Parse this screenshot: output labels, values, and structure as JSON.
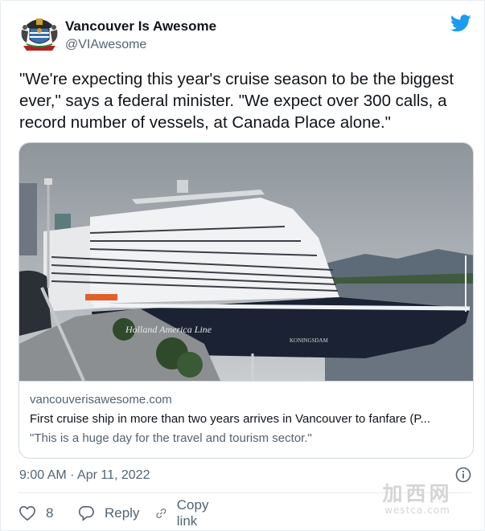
{
  "account": {
    "display_name": "Vancouver Is Awesome",
    "handle": "@VIAwesome",
    "avatar_icon": "vancouver-coat-of-arms-icon",
    "platform_icon": "twitter-bird-icon",
    "platform_color": "#1d9bf0"
  },
  "tweet": {
    "text": "\"We're expecting this year's cruise season to be the biggest ever,\" says a federal minister. \"We expect over 300 calls, a record number of vessels, at Canada Place alone.\"",
    "timestamp": "9:00 AM · Apr 11, 2022"
  },
  "link_card": {
    "photo_caption_hull": "Holland America Line",
    "photo_caption_bow": "KONINGSDAM",
    "domain": "vancouverisawesome.com",
    "title": "First cruise ship in more than two years arrives in Vancouver to fanfare (P...",
    "description": "\"This is a huge day for the travel and tourism sector.\""
  },
  "actions": {
    "like_count": "8",
    "reply_label": "Reply",
    "copy_link_label": "Copy link"
  },
  "watermark": {
    "line1": "加西网",
    "line2": "westca.com"
  }
}
